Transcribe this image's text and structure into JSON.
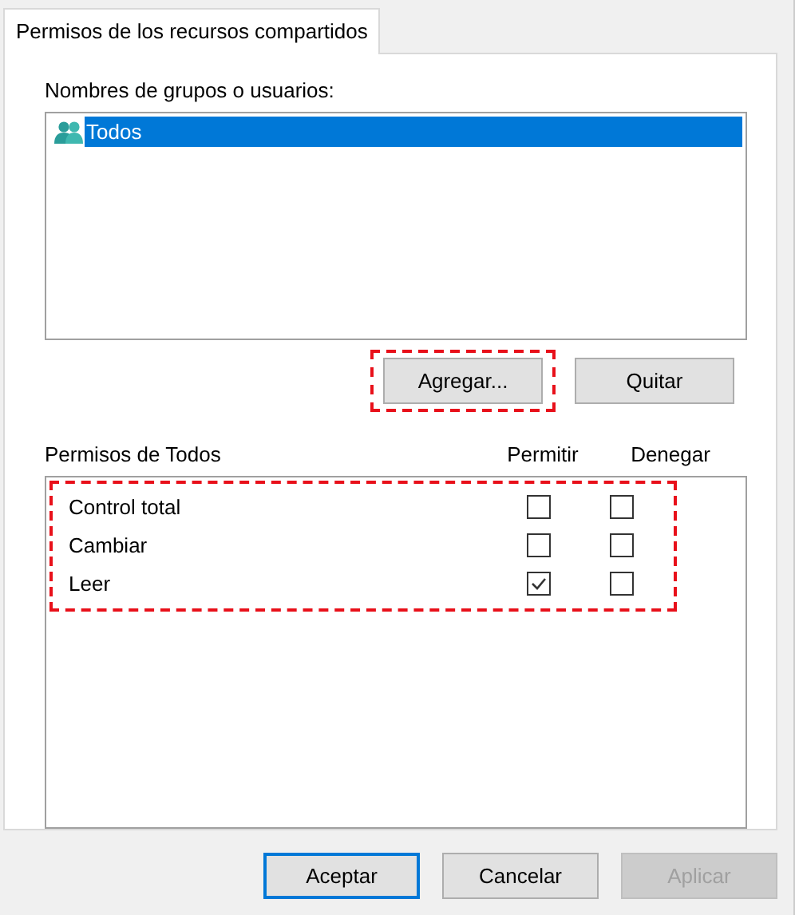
{
  "tabs": [
    {
      "label": "Permisos de los recursos compartidos",
      "selected": true
    }
  ],
  "groups": {
    "label": "Nombres de grupos o usuarios:",
    "items": [
      {
        "name": "Todos",
        "selected": true
      }
    ]
  },
  "group_buttons": [
    {
      "label": "Agregar...",
      "highlighted": true
    },
    {
      "label": "Quitar",
      "highlighted": false
    }
  ],
  "permissions": {
    "label": "Permisos de Todos",
    "columns": [
      "Permitir",
      "Denegar"
    ],
    "highlighted": true,
    "rows": [
      {
        "name": "Control total",
        "allow": false,
        "deny": false
      },
      {
        "name": "Cambiar",
        "allow": false,
        "deny": false
      },
      {
        "name": "Leer",
        "allow": true,
        "deny": false
      }
    ]
  },
  "buttons": [
    {
      "label": "Aceptar",
      "default": true,
      "disabled": false
    },
    {
      "label": "Cancelar",
      "default": false,
      "disabled": false
    },
    {
      "label": "Aplicar",
      "default": false,
      "disabled": true
    }
  ]
}
